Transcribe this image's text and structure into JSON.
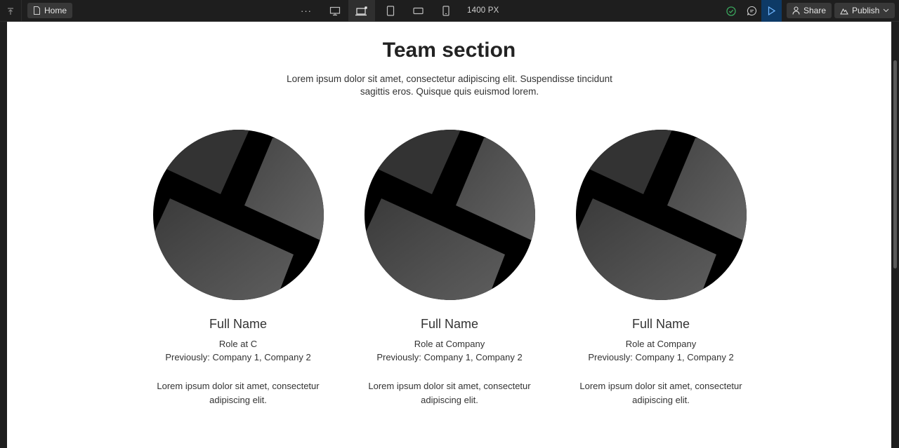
{
  "toolbar": {
    "page_label": "Home",
    "width_readout": "1400 PX",
    "share_label": "Share",
    "publish_label": "Publish"
  },
  "page": {
    "title": "Team section",
    "subtitle": "Lorem ipsum dolor sit amet, consectetur adipiscing elit. Suspendisse tincidunt sagittis eros. Quisque quis euismod lorem."
  },
  "team": [
    {
      "name": "Full Name",
      "role": "Role at C",
      "previously": "Previously: Company 1, Company 2",
      "bio": "Lorem ipsum dolor sit amet, consectetur adipiscing elit."
    },
    {
      "name": "Full Name",
      "role": "Role at Company",
      "previously": "Previously: Company 1, Company 2",
      "bio": "Lorem ipsum dolor sit amet, consectetur adipiscing elit."
    },
    {
      "name": "Full Name",
      "role": "Role at Company",
      "previously": "Previously: Company 1, Company 2",
      "bio": "Lorem ipsum dolor sit amet, consectetur adipiscing elit."
    }
  ],
  "colors": {
    "play_button_bg": "#0e3a66",
    "status_ok": "#3aa55d"
  }
}
